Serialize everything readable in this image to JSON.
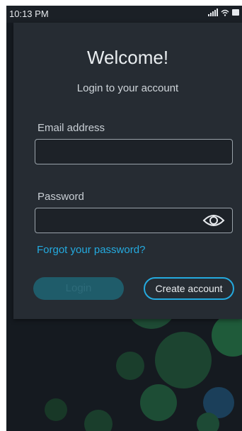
{
  "status_bar": {
    "time": "10:13 PM",
    "icons": [
      "signal-icon",
      "wifi-icon",
      "battery-icon"
    ]
  },
  "login": {
    "title": "Welcome!",
    "subtitle": "Login to your account",
    "email": {
      "label": "Email address",
      "value": "",
      "placeholder": ""
    },
    "password": {
      "label": "Password",
      "value": "",
      "placeholder": ""
    },
    "forgot_link": "Forgot your password?",
    "login_button": "Login",
    "create_account_button": "Create account"
  },
  "colors": {
    "background": "#151a20",
    "card": "#262c33",
    "accent": "#24aadf",
    "login_disabled": "#1f5c6a",
    "art": "#1f5a38"
  }
}
